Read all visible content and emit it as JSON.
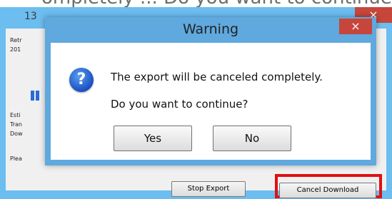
{
  "top_fragment": "ompletely ... Do you want to continue? Cancel ...",
  "parent_window": {
    "title_fragment": "13",
    "close_glyph": "×",
    "labels": [
      "Retr",
      "201",
      "Esti",
      "Tran",
      "Dow",
      "Plea"
    ],
    "buttons": {
      "stop_export": "Stop Export",
      "cancel_download": "Cancel Download"
    }
  },
  "dialog": {
    "title": "Warning",
    "close_glyph": "×",
    "icon": "question-icon",
    "icon_glyph": "?",
    "message_line1": "The export will be canceled completely.",
    "message_line2": "Do you want to continue?",
    "yes_label": "Yes",
    "no_label": "No"
  },
  "colors": {
    "frame_blue": "#6cbdf0",
    "dialog_blue": "#5fa9df",
    "close_red": "#c6463b",
    "highlight_red": "#e01010"
  }
}
